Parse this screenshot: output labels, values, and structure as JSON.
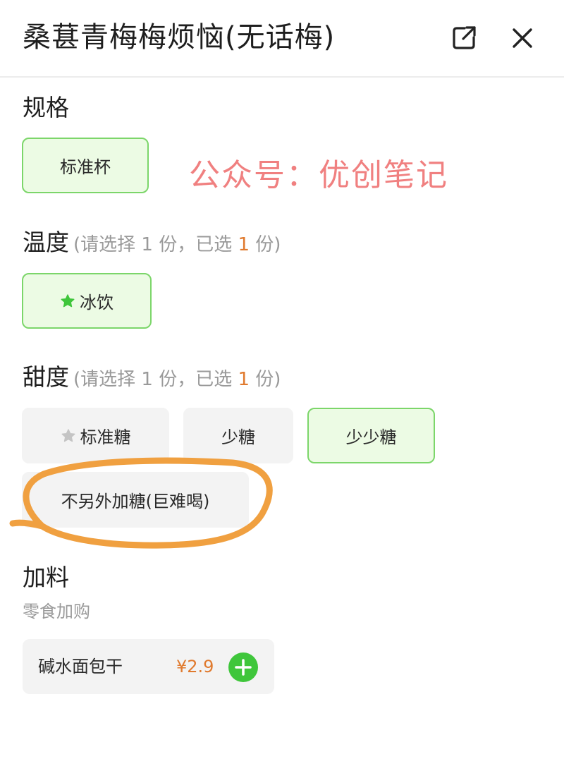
{
  "header": {
    "title": "桑葚青梅梅烦恼(无话梅)",
    "share_icon": "share-external-icon",
    "close_icon": "close-icon"
  },
  "watermark": "公众号：优创笔记",
  "spec": {
    "title": "规格",
    "options": [
      {
        "label": "标准杯",
        "selected": true
      }
    ]
  },
  "temperature": {
    "title": "温度",
    "hint_prefix": "(请选择 1 份，已选 ",
    "hint_count": "1",
    "hint_suffix": " 份)",
    "options": [
      {
        "label": "冰饮",
        "selected": true,
        "icon": "star-icon"
      }
    ]
  },
  "sweetness": {
    "title": "甜度",
    "hint_prefix": "(请选择 1 份，已选 ",
    "hint_count": "1",
    "hint_suffix": " 份)",
    "options": [
      {
        "label": "标准糖",
        "selected": false,
        "icon": "star-icon"
      },
      {
        "label": "少糖",
        "selected": false
      },
      {
        "label": "少少糖",
        "selected": true
      },
      {
        "label": "不另外加糖(巨难喝)",
        "selected": false
      }
    ]
  },
  "toppings": {
    "title": "加料",
    "subtitle": "零食加购",
    "items": [
      {
        "name": "碱水面包干",
        "price": "¥2.9",
        "add_icon": "plus-icon"
      }
    ]
  },
  "colors": {
    "selected_border": "#7cd66a",
    "selected_bg": "#ecfbe4",
    "accent_green": "#3fc63b",
    "price_orange": "#e07a2e",
    "watermark_red": "#f08080",
    "annotation_orange": "#f0a040"
  }
}
